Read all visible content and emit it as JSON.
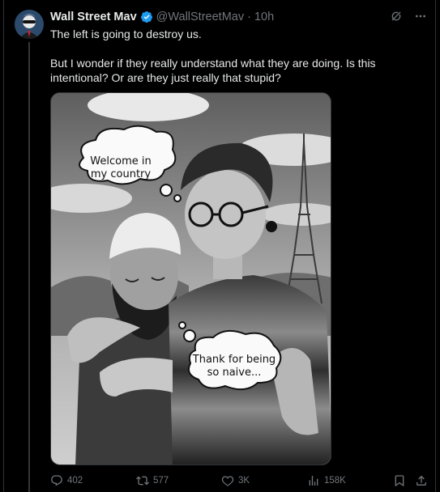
{
  "tweet": {
    "author_name": "Wall Street Mav",
    "handle": "@WallStreetMav",
    "separator": "·",
    "time": "10h",
    "paragraphs": [
      "The left is going to destroy us.",
      "But I wonder if they really understand what they are doing. Is this intentional? Or are they just really that stupid?"
    ],
    "image": {
      "bubble_left_line1": "Welcome in",
      "bubble_left_line2": "my country",
      "bubble_right_line1": "Thank for being",
      "bubble_right_line2": "so naive..."
    },
    "actions": {
      "replies": "402",
      "reposts": "577",
      "likes": "3K",
      "views": "158K"
    }
  },
  "icons": {
    "verified": "verified-badge-icon",
    "grok": "grok-icon",
    "more": "more-icon",
    "reply": "reply-icon",
    "repost": "repost-icon",
    "like": "like-icon",
    "views": "views-icon",
    "bookmark": "bookmark-icon",
    "share": "share-icon"
  },
  "colors": {
    "background": "#000000",
    "text": "#e7e9ea",
    "muted": "#71767b",
    "verified": "#1d9bf0",
    "border": "#2f3336"
  }
}
